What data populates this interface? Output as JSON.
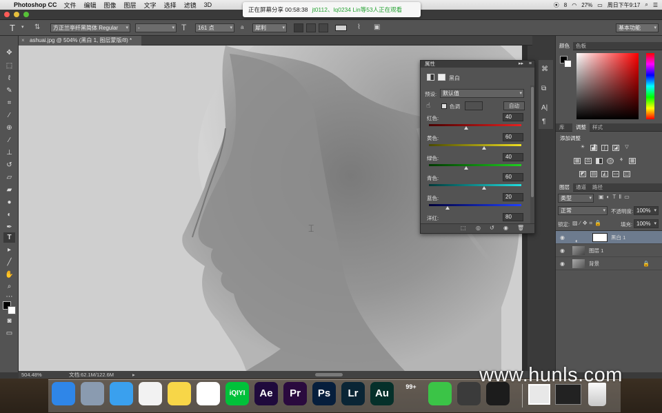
{
  "menubar": {
    "app_name": "Photoshop CC",
    "items": [
      "文件",
      "编辑",
      "图像",
      "图层",
      "文字",
      "选择",
      "滤镜",
      "3D"
    ],
    "right_items": [
      "8",
      "27%",
      "周日下午9:17"
    ]
  },
  "share_banner": {
    "text": "正在屏幕分享 00:58:38",
    "viewers": "jt0112、lq0234 Lin等53人正在观看"
  },
  "options_bar": {
    "font_family": "方正兰亭纤黑简体 Regular",
    "font_style": "-",
    "font_size": "161 点",
    "aa_label": "a",
    "antialias": "犀利",
    "workspace": "基本功能"
  },
  "document": {
    "tab_title": "ashuai.jpg @ 504% (黑白 1, 图层蒙版/8) *",
    "zoom": "504.48%",
    "doc_info": "文档:62.1M/122.6M"
  },
  "properties": {
    "panel_title": "属性",
    "adjustment_name": "黑白",
    "preset_label": "预设:",
    "preset_value": "默认值",
    "tint_label": "色调",
    "auto_button": "自动",
    "sliders": [
      {
        "label": "红色:",
        "value": 40,
        "max": 100,
        "from": "#4a0000",
        "to": "#e82020"
      },
      {
        "label": "黄色:",
        "value": 60,
        "max": 100,
        "from": "#4a4a00",
        "to": "#f0e020"
      },
      {
        "label": "绿色:",
        "value": 40,
        "max": 100,
        "from": "#003a00",
        "to": "#20d020"
      },
      {
        "label": "青色:",
        "value": 60,
        "max": 100,
        "from": "#003a3a",
        "to": "#20e0e0"
      },
      {
        "label": "蓝色:",
        "value": 20,
        "max": 100,
        "from": "#00003a",
        "to": "#2040ff"
      },
      {
        "label": "洋红:",
        "value": 80,
        "max": 100,
        "from": "#3a003a",
        "to": "#e020e0"
      }
    ]
  },
  "color_panel": {
    "tabs": [
      "颜色",
      "色板"
    ],
    "hue_color": "#ff0000"
  },
  "adjust_panel": {
    "tabs": [
      "库",
      "调整",
      "样式"
    ],
    "title": "添加调整"
  },
  "layers_panel": {
    "tabs": [
      "图层",
      "通道",
      "路径"
    ],
    "filter": "类型",
    "blend_mode": "正常",
    "opacity_label": "不透明度:",
    "opacity": "100%",
    "lock_label": "锁定:",
    "fill_label": "填充:",
    "fill": "100%",
    "layers": [
      {
        "name": "黑白 1",
        "selected": true
      },
      {
        "name": "图层 1",
        "selected": false
      },
      {
        "name": "背景",
        "selected": false
      }
    ]
  },
  "dock_apps": [
    {
      "icon": "finder-icon",
      "label": "",
      "bg": "#2f86e8"
    },
    {
      "icon": "launchpad-icon",
      "label": "",
      "bg": "#8a9bb0"
    },
    {
      "icon": "safari-icon",
      "label": "",
      "bg": "#3aa0ee"
    },
    {
      "icon": "reminders-icon",
      "label": "",
      "bg": "#f2f2f2"
    },
    {
      "icon": "notes-icon",
      "label": "",
      "bg": "#f7d648"
    },
    {
      "icon": "photos-icon",
      "label": "",
      "bg": "#ffffff"
    },
    {
      "icon": "iqiyi-icon",
      "label": "iQIYI",
      "bg": "#00c13a"
    },
    {
      "icon": "after-effects-icon",
      "label": "Ae",
      "bg": "#1f0a3c"
    },
    {
      "icon": "premiere-icon",
      "label": "Pr",
      "bg": "#2a0a3e"
    },
    {
      "icon": "photoshop-icon",
      "label": "Ps",
      "bg": "#061e3c"
    },
    {
      "icon": "lightroom-icon",
      "label": "Lr",
      "bg": "#0a2535"
    },
    {
      "icon": "audition-icon",
      "label": "Au",
      "bg": "#05302a"
    },
    {
      "icon": "qq-icon",
      "label": "99+",
      "bg": "transparent"
    },
    {
      "icon": "wechat-icon",
      "label": "",
      "bg": "#3bc447"
    },
    {
      "icon": "image-capture-icon",
      "label": "",
      "bg": "#3b3b3b"
    },
    {
      "icon": "quicktime-icon",
      "label": "",
      "bg": "#1c1c1c"
    }
  ],
  "watermark": "www.hunls.com"
}
